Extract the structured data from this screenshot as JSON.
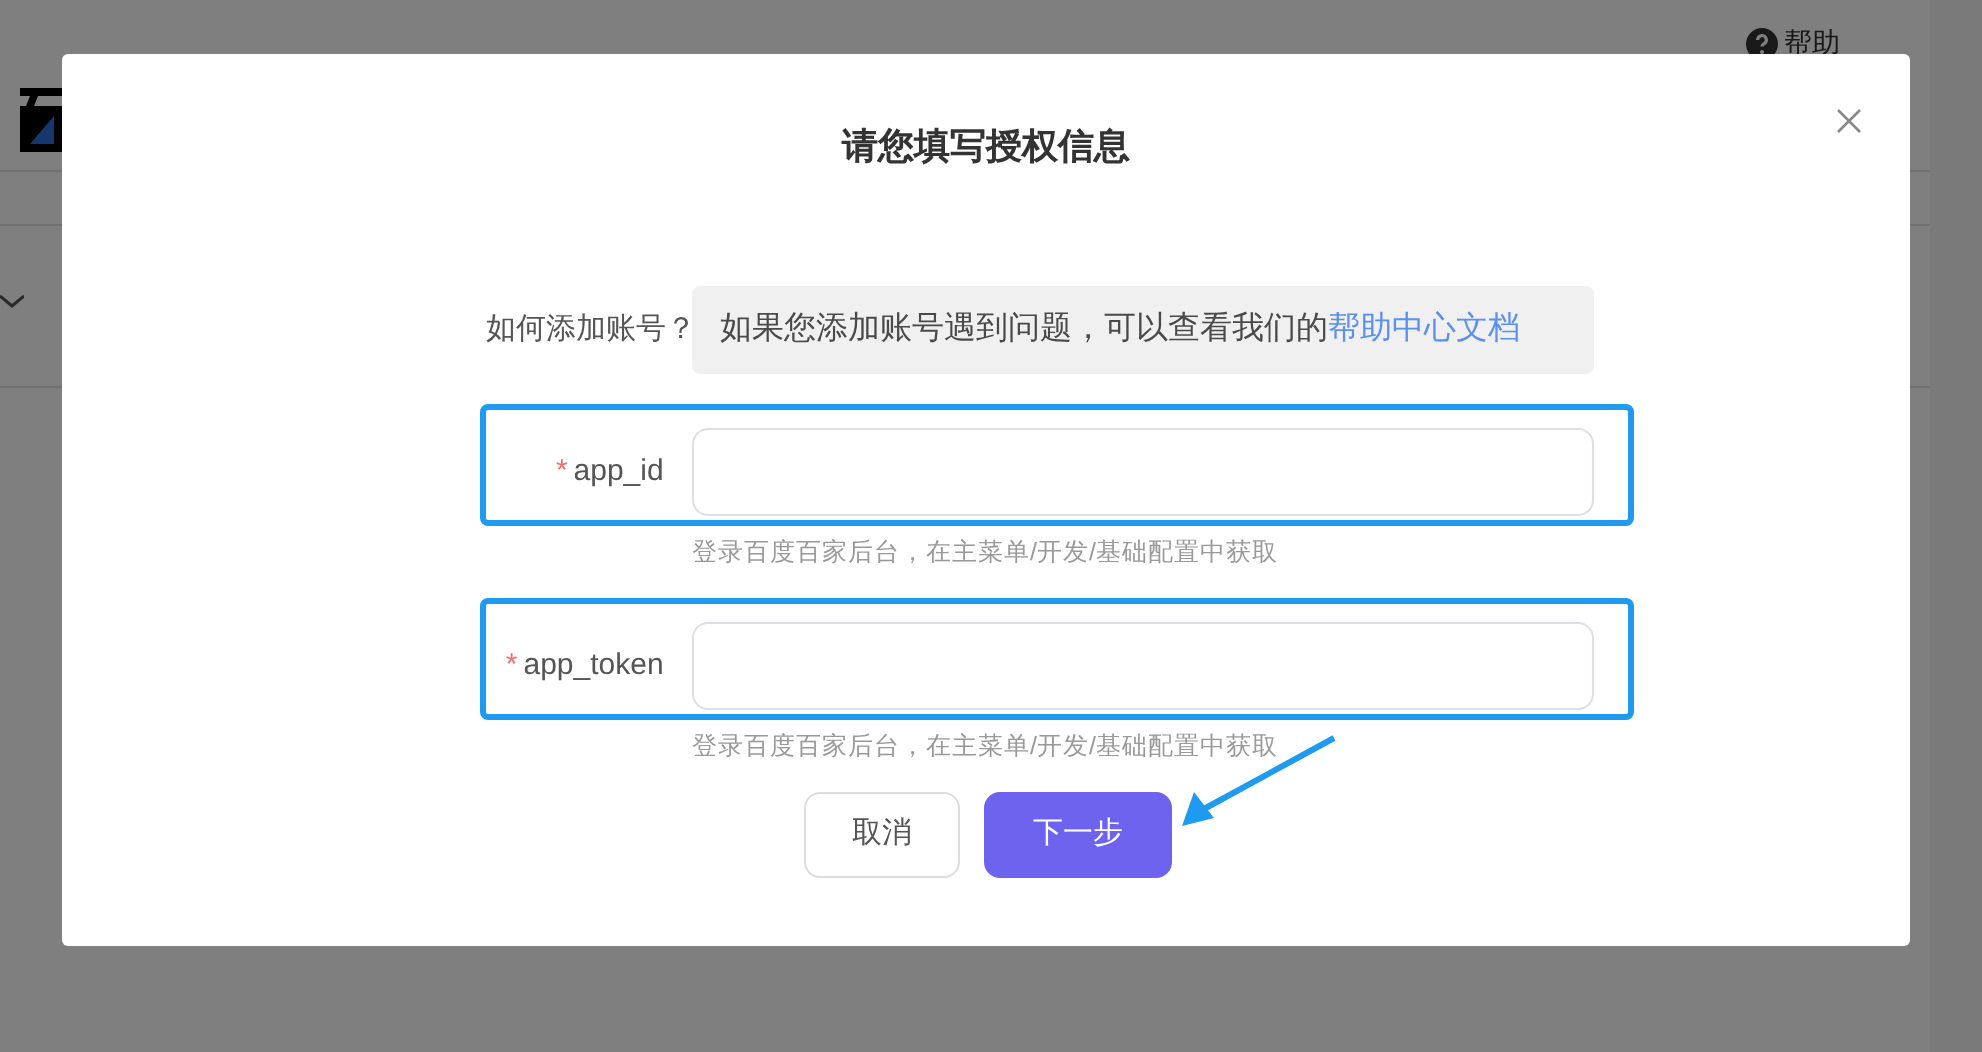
{
  "background": {
    "help_link": "帮助"
  },
  "dialog": {
    "title": "请您填写授权信息",
    "info": {
      "label": "如何添加账号？",
      "text": "如果您添加账号遇到问题，可以查看我们的",
      "link": "帮助中心文档"
    },
    "fields": [
      {
        "required_mark": "*",
        "label": "app_id",
        "hint": "登录百度百家后台，在主菜单/开发/基础配置中获取",
        "highlighted": true
      },
      {
        "required_mark": "*",
        "label": "app_token",
        "hint": "登录百度百家后台，在主菜单/开发/基础配置中获取",
        "highlighted": true
      }
    ],
    "buttons": [
      {
        "label": "取消",
        "kind": "secondary",
        "arrow_pointing": false
      },
      {
        "label": "下一步",
        "kind": "primary",
        "arrow_pointing": true
      }
    ]
  }
}
